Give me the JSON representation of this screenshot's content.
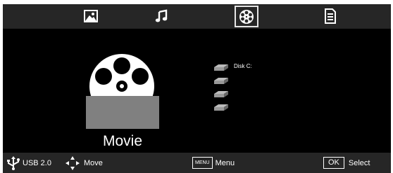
{
  "tabs": [
    {
      "id": "photo",
      "icon": "photo-icon",
      "active": false
    },
    {
      "id": "music",
      "icon": "music-note-icon",
      "active": false
    },
    {
      "id": "movie",
      "icon": "film-reel-icon",
      "active": true
    },
    {
      "id": "text",
      "icon": "document-icon",
      "active": false
    }
  ],
  "category": {
    "label": "Movie",
    "icon": "film-reel-icon"
  },
  "disks": [
    {
      "label": "Disk C:",
      "icon": "disk-drive-icon"
    },
    {
      "label": "",
      "icon": "disk-drive-icon"
    },
    {
      "label": "",
      "icon": "disk-drive-icon"
    },
    {
      "label": "",
      "icon": "disk-drive-icon"
    }
  ],
  "bottom_bar": {
    "usb_label": "USB 2.0",
    "move_label": "Move",
    "menu_key": "MENU",
    "menu_label": "Menu",
    "ok_key": "OK",
    "select_label": "Select"
  }
}
